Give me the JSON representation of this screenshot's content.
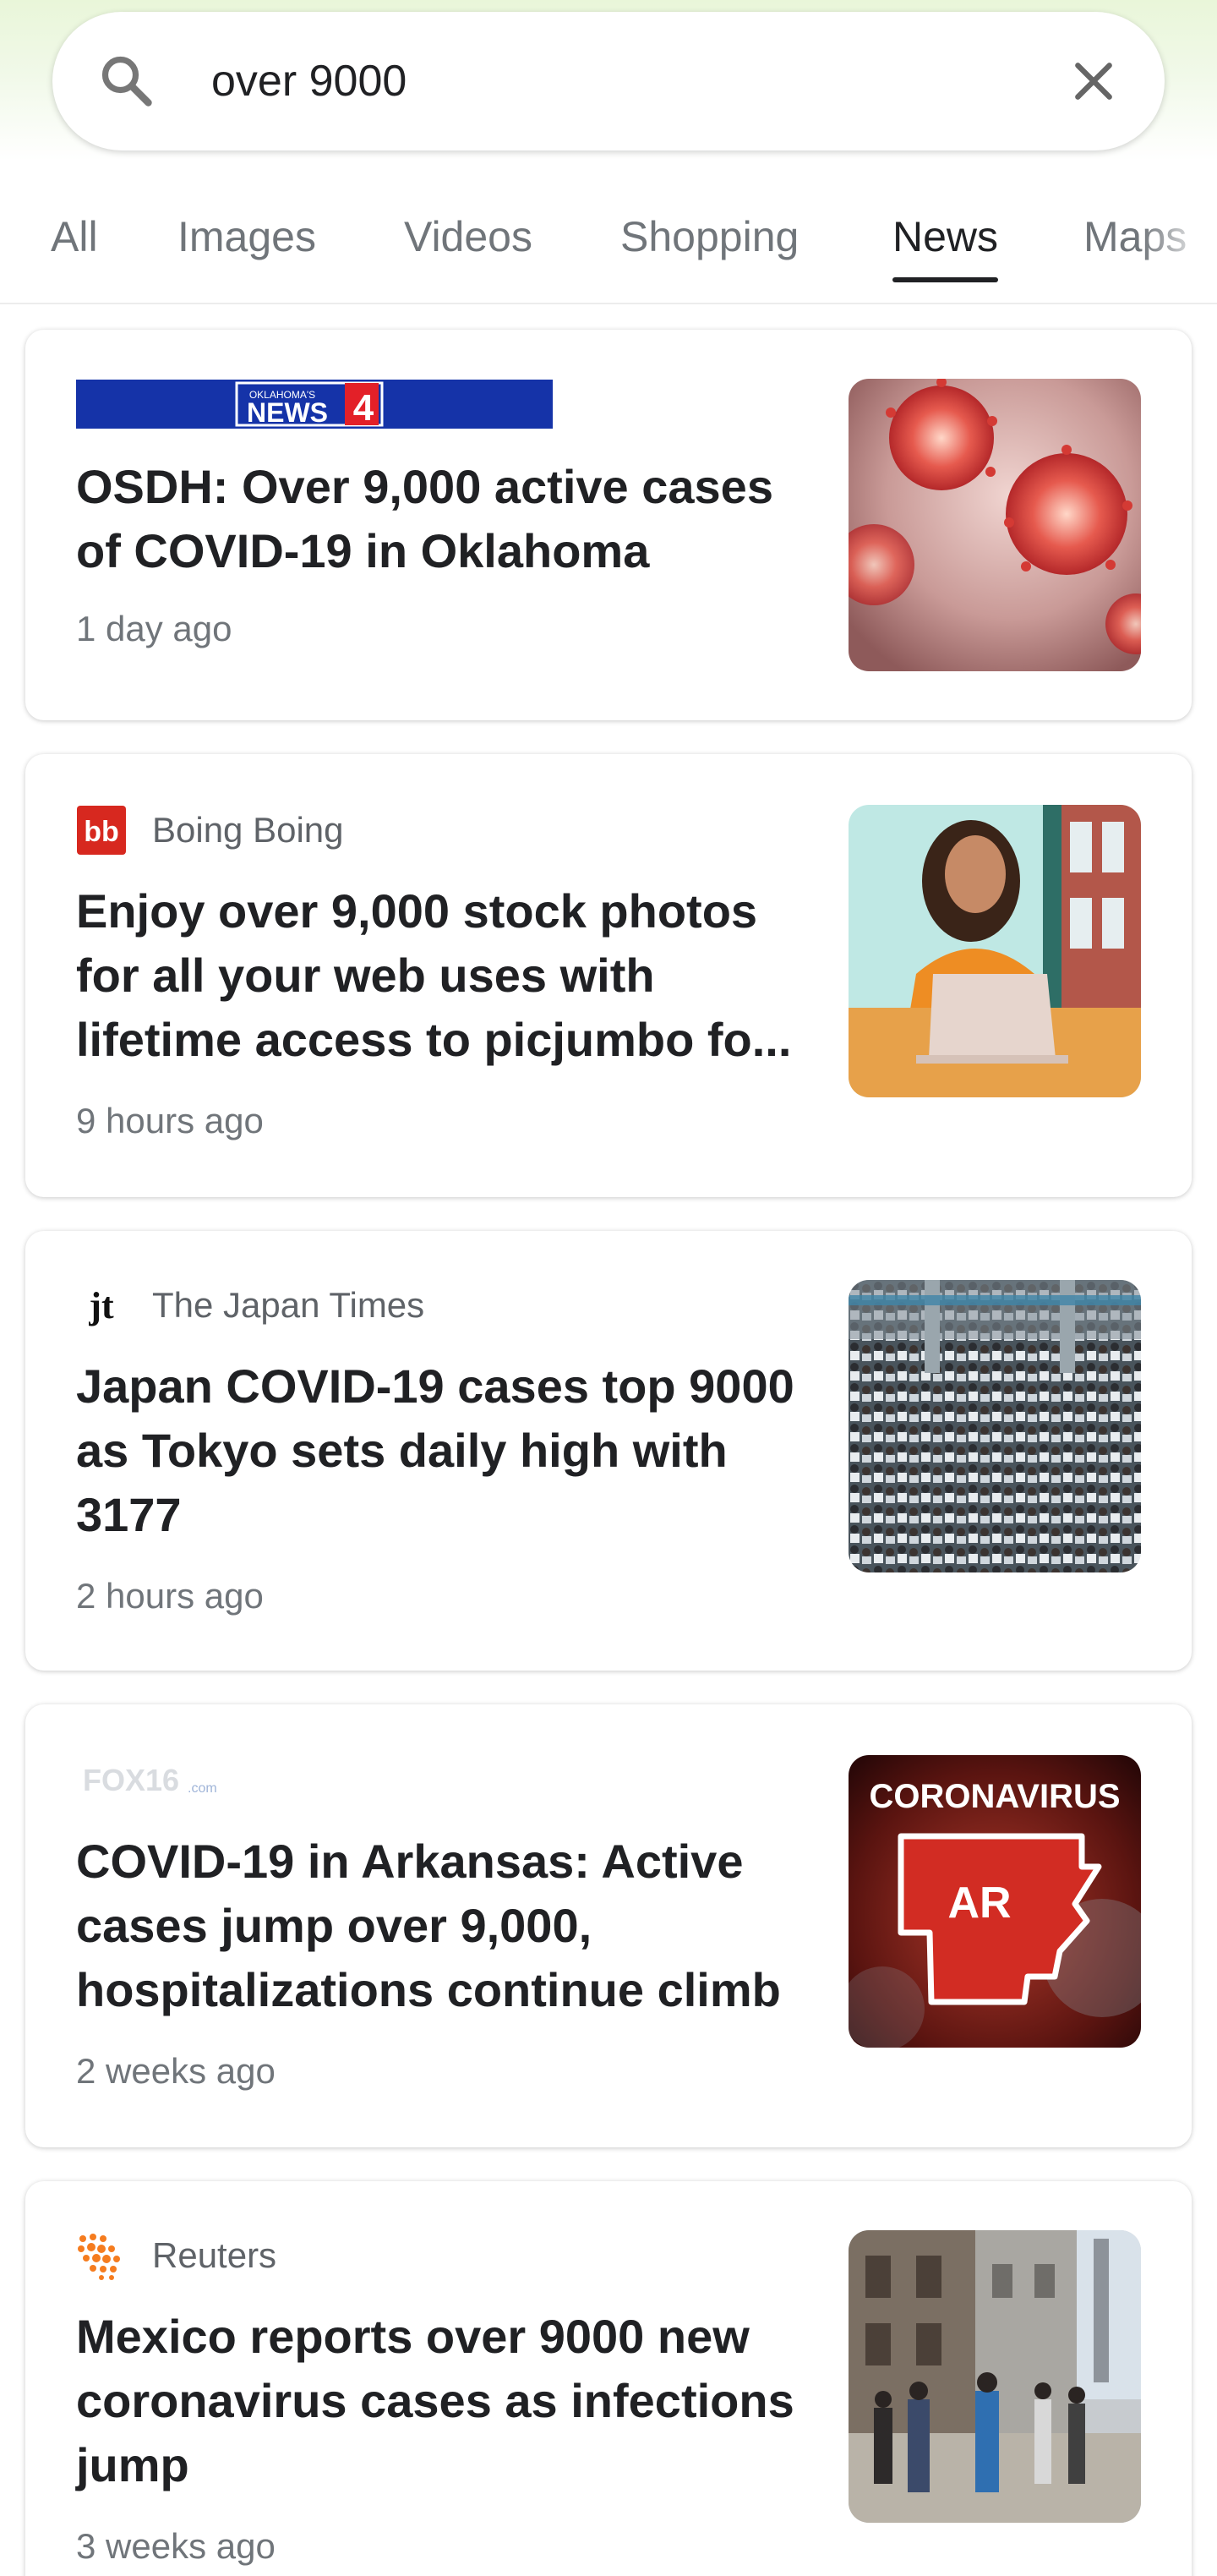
{
  "search": {
    "query": "over 9000",
    "search_icon": "search-icon",
    "clear_icon": "close-icon"
  },
  "tabs": [
    {
      "label": "All",
      "active": false
    },
    {
      "label": "Images",
      "active": false
    },
    {
      "label": "Videos",
      "active": false
    },
    {
      "label": "Shopping",
      "active": false
    },
    {
      "label": "News",
      "active": true
    },
    {
      "label": "Maps",
      "active": false
    }
  ],
  "articles": [
    {
      "source": "",
      "logo_text": "NEWS",
      "logo_subtext": "OKLAHOMA'S",
      "logo_badge": "4",
      "headline": "OSDH: Over 9,000 active cases of COVID-19 in Oklahoma",
      "time": "1 day ago",
      "thumb": "coronavirus-particles-image"
    },
    {
      "source": "Boing Boing",
      "logo_text": "bb",
      "headline": "Enjoy over 9,000 stock photos for all your web uses with lifetime access to picjumbo fo...",
      "time": "9 hours ago",
      "thumb": "woman-laptop-image"
    },
    {
      "source": "The Japan Times",
      "logo_text": "jt",
      "headline": "Japan COVID-19 cases top 9000 as Tokyo sets daily high with 3177",
      "time": "2 hours ago",
      "thumb": "crowd-image"
    },
    {
      "source": "",
      "logo_text": "FOX16",
      "logo_subtext": ".com",
      "headline": "COVID-19 in Arkansas: Active cases jump over 9,000, hospitalizations continue climb",
      "time": "2 weeks ago",
      "thumb": "coronavirus-arkansas-image",
      "thumb_title": "CORONAVIRUS",
      "thumb_label": "AR"
    },
    {
      "source": "Reuters",
      "logo_text": "",
      "headline": "Mexico reports over 9000 new coronavirus cases as infections jump",
      "time": "3 weeks ago",
      "thumb": "street-scene-image"
    }
  ],
  "colors": {
    "accent": "#202124",
    "muted": "#70757a",
    "news4_blue": "#1533a8",
    "news4_red": "#e32028",
    "boing_red": "#d7281f",
    "reuters_orange": "#f57c1f"
  }
}
